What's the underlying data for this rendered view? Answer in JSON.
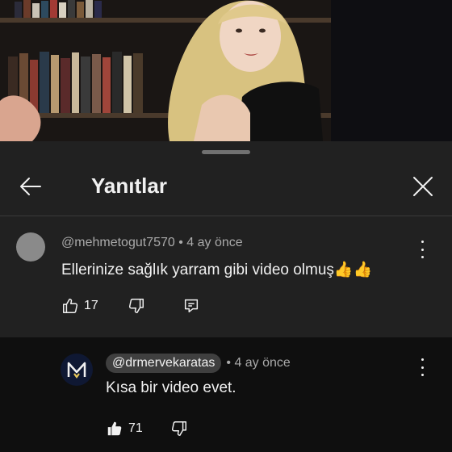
{
  "header": {
    "title": "Yanıtlar"
  },
  "comment": {
    "author": "@mehmetogut7570",
    "time": "• 4 ay önce",
    "text": "Ellerinize sağlık yarram gibi video olmuş👍👍",
    "likes": "17"
  },
  "reply": {
    "author": "@drmervekaratas",
    "time": "• 4 ay önce",
    "text": "Kısa bir video evet.",
    "likes": "71",
    "avatar_letter": "M"
  },
  "colors": {
    "panel": "#212121",
    "reply_bg": "#0f0f0f",
    "avatar_brand": "#0f1833",
    "avatar_accent": "#e8c85a"
  }
}
